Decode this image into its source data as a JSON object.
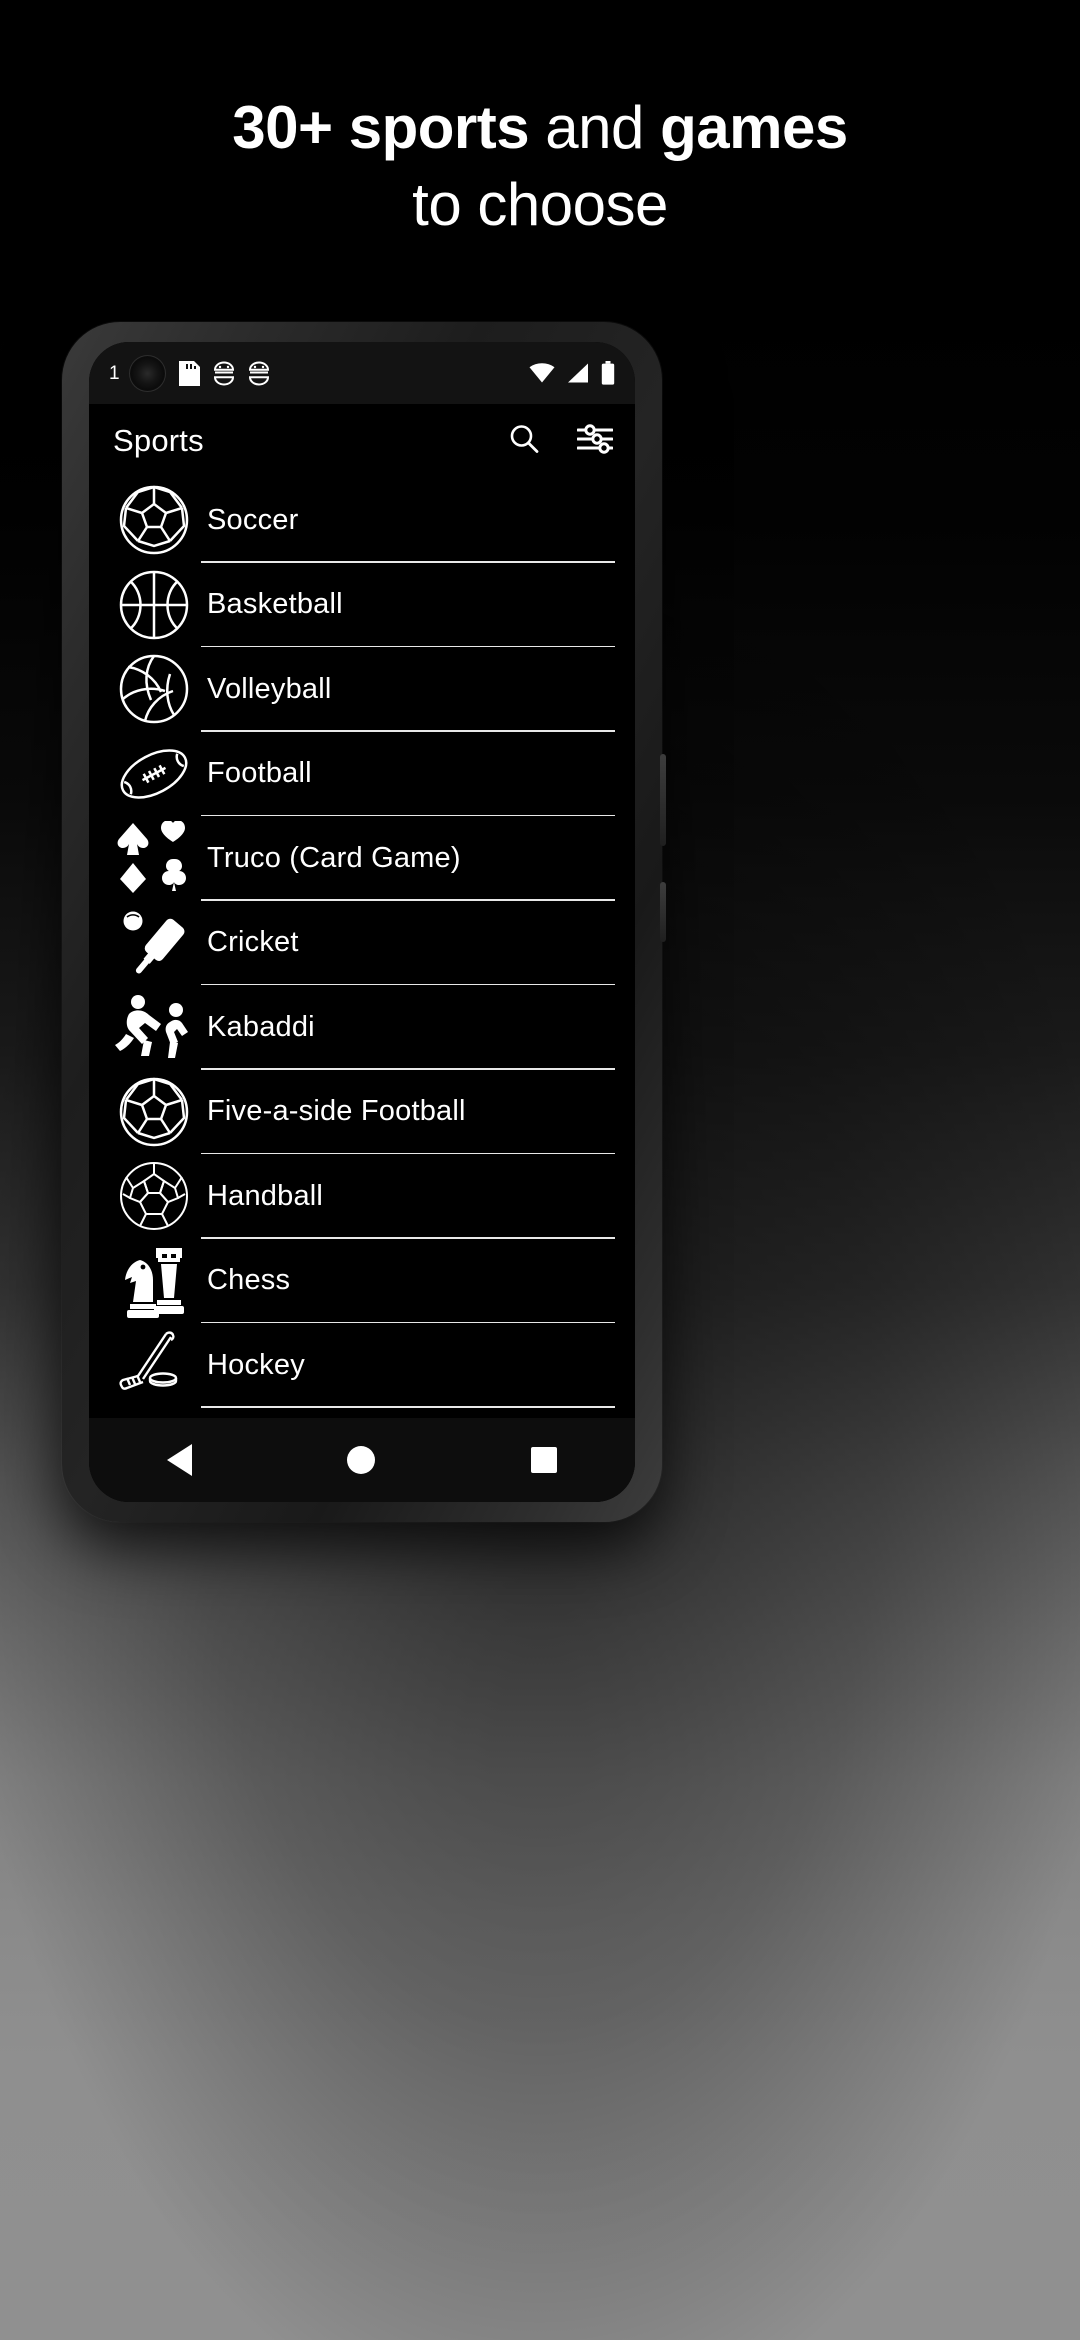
{
  "promo": {
    "headline_line1_bold1": "30+ sports",
    "headline_line1_regular": " and ",
    "headline_line1_bold2": "games",
    "headline_line2": "to choose",
    "background_top_color": "#000000",
    "background_bottom_color": "#909090",
    "text_color": "#ffffff"
  },
  "phone": {
    "statusbar": {
      "notification_count": "1",
      "icons_left": [
        "camera-punchhole",
        "sd-card-icon",
        "android-debug-icon",
        "android-debug-icon"
      ],
      "icons_right": [
        "wifi-icon",
        "cellular-signal-icon",
        "battery-icon"
      ]
    },
    "appbar": {
      "title": "Sports",
      "actions": [
        {
          "name": "search-icon",
          "label": "Search"
        },
        {
          "name": "filter-tune-icon",
          "label": "Filter"
        }
      ]
    },
    "list": {
      "items": [
        {
          "label": "Soccer",
          "icon": "soccer-ball-icon"
        },
        {
          "label": "Basketball",
          "icon": "basketball-icon"
        },
        {
          "label": "Volleyball",
          "icon": "volleyball-icon"
        },
        {
          "label": "Football",
          "icon": "american-football-icon"
        },
        {
          "label": "Truco (Card Game)",
          "icon": "card-suits-icon"
        },
        {
          "label": "Cricket",
          "icon": "cricket-bat-ball-icon"
        },
        {
          "label": "Kabaddi",
          "icon": "kabaddi-players-icon"
        },
        {
          "label": "Five-a-side Football",
          "icon": "soccer-ball-icon"
        },
        {
          "label": "Handball",
          "icon": "handball-icon"
        },
        {
          "label": "Chess",
          "icon": "chess-pieces-icon"
        },
        {
          "label": "Hockey",
          "icon": "hockey-stick-puck-icon"
        }
      ]
    },
    "navbar": {
      "buttons": [
        {
          "name": "nav-back-button",
          "label": "Back"
        },
        {
          "name": "nav-home-button",
          "label": "Home"
        },
        {
          "name": "nav-recents-button",
          "label": "Recents"
        }
      ]
    }
  }
}
